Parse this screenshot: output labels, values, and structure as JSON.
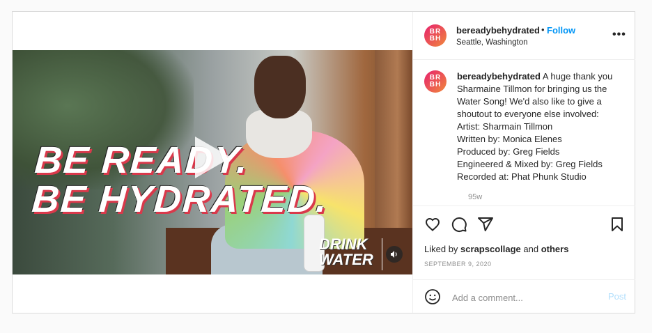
{
  "post": {
    "username": "bereadybehydrated",
    "follow_label": "Follow",
    "separator": "•",
    "location": "Seattle, Washington",
    "more_label": "•••",
    "avatar_text_top": "BR",
    "avatar_text_bottom": "BH",
    "accent_color": "#0095f6"
  },
  "video": {
    "headline_line1": "BE READY.",
    "headline_line2": "BE HYDRATED.",
    "logo_line1": "DRINK",
    "logo_line2": "WATER",
    "play_icon": "play-icon",
    "sound_icon": "speaker-icon"
  },
  "caption": {
    "username": "bereadybehydrated",
    "lines": [
      " A huge thank you",
      "Sharmaine Tillmon for bringing us the",
      "Water Song! We'd also like to give a",
      "shoutout to everyone else involved:",
      "Artist: Sharmain Tillmon",
      "Written by: Monica Elenes",
      "Produced by: Greg Fields",
      "Engineered & Mixed by: Greg Fields",
      "Recorded at: Phat Phunk Studio"
    ],
    "time": "95w"
  },
  "actions": {
    "icons": [
      "heart-icon",
      "comment-icon",
      "share-icon",
      "bookmark-icon"
    ],
    "liked_prefix": "Liked by ",
    "liked_user": "scrapscollage",
    "liked_middle": " and ",
    "liked_others": "others",
    "date": "SEPTEMBER 9, 2020"
  },
  "comment": {
    "placeholder": "Add a comment...",
    "post_label": "Post",
    "emoji_icon": "smile-icon"
  }
}
